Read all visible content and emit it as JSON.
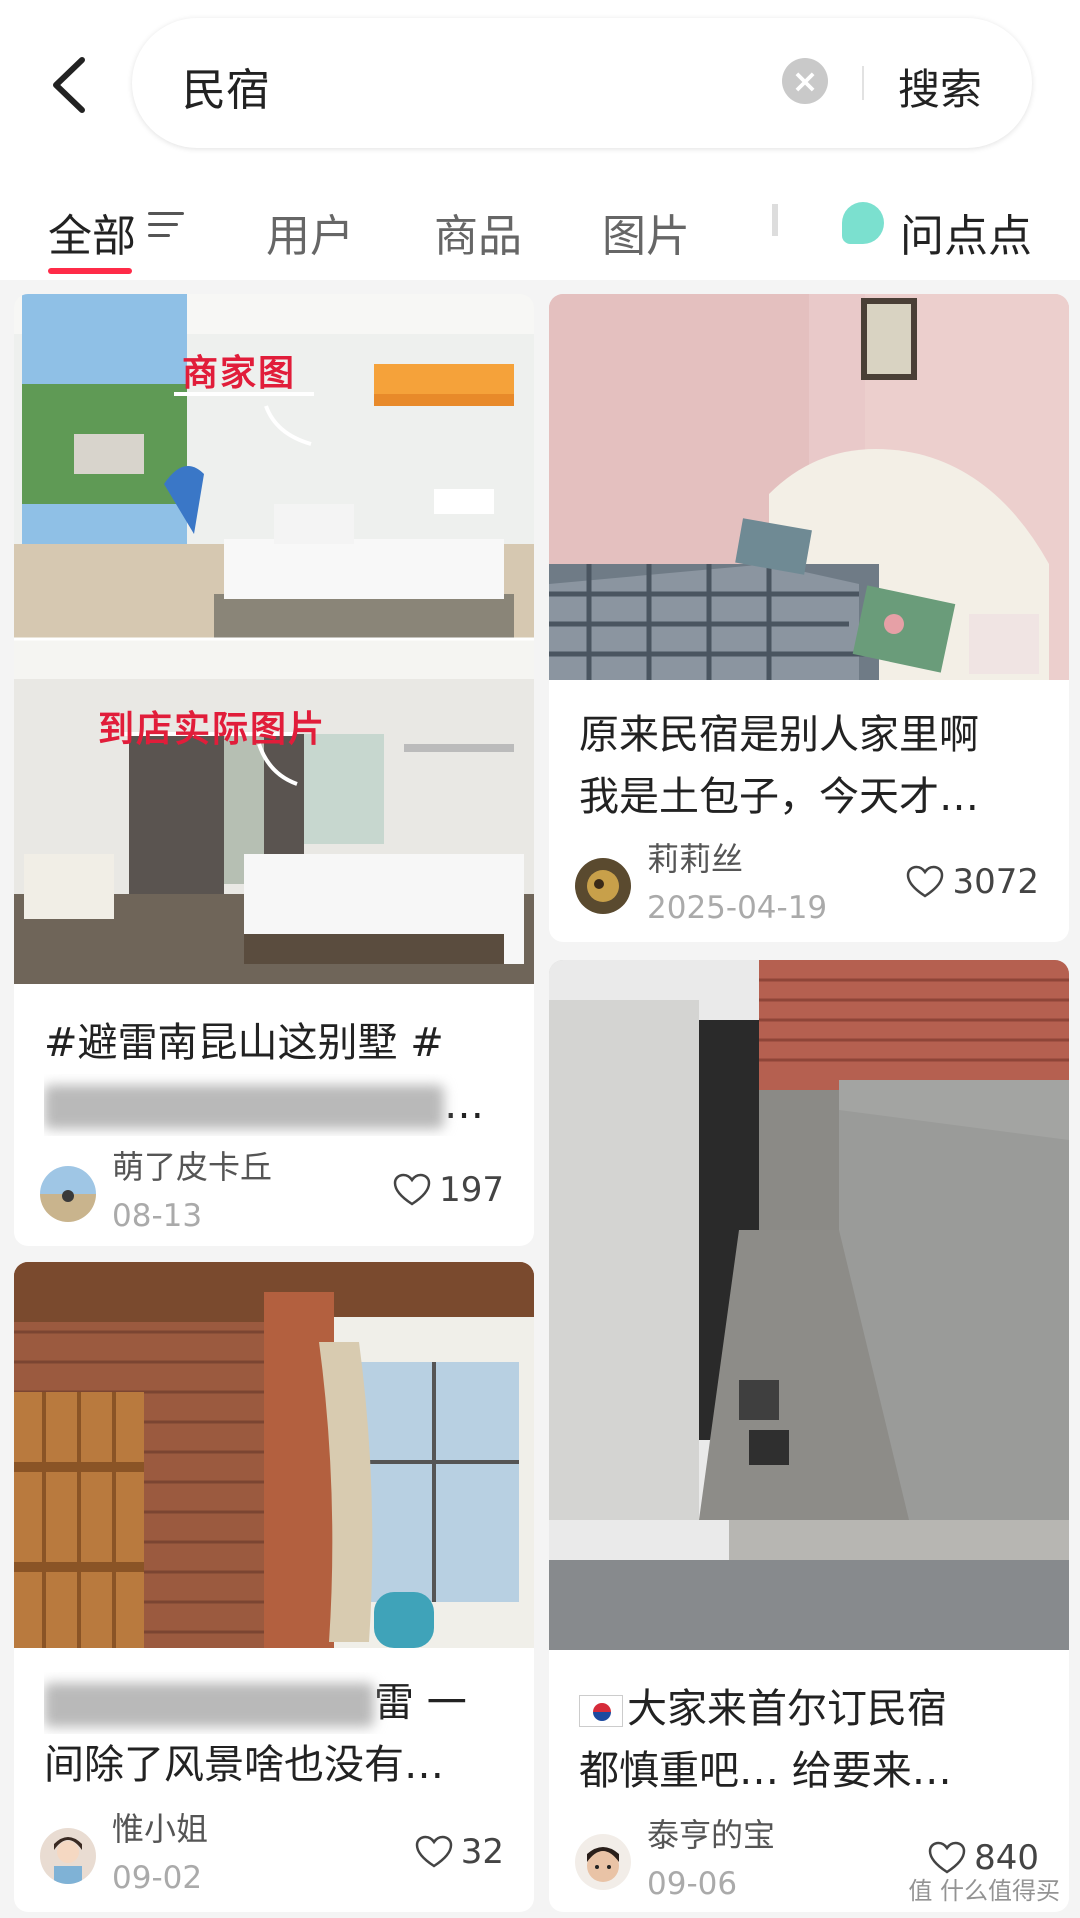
{
  "search": {
    "query": "民宿",
    "button_label": "搜索"
  },
  "tabs": [
    {
      "label": "全部",
      "active": true
    },
    {
      "label": "用户",
      "active": false
    },
    {
      "label": "商品",
      "active": false
    },
    {
      "label": "图片",
      "active": false
    }
  ],
  "ask": {
    "label": "问点点"
  },
  "notes": [
    {
      "title_line1": "#避雷南昆山这别墅 #",
      "title_line2_tail": "…",
      "author": "萌了皮卡丘",
      "date": "08-13",
      "likes": "197",
      "overlay_top": "商家图",
      "overlay_bottom": "到店实际图片"
    },
    {
      "title_line1": "原来民宿是别人家里啊",
      "title_line2": "我是土包子，今天才…",
      "author": "莉莉丝",
      "date": "2025-04-19",
      "likes": "3072"
    },
    {
      "title_line1_tail": "雷 一",
      "title_line2": "间除了风景啥也没有…",
      "author": "惟小姐",
      "date": "09-02",
      "likes": "32"
    },
    {
      "title_line1": "大家来首尔订民宿",
      "title_line2": "都慎重吧… 给要来…",
      "author": "泰亨的宝",
      "date": "09-06",
      "likes": "840"
    }
  ],
  "watermark": "值 什么值得买"
}
